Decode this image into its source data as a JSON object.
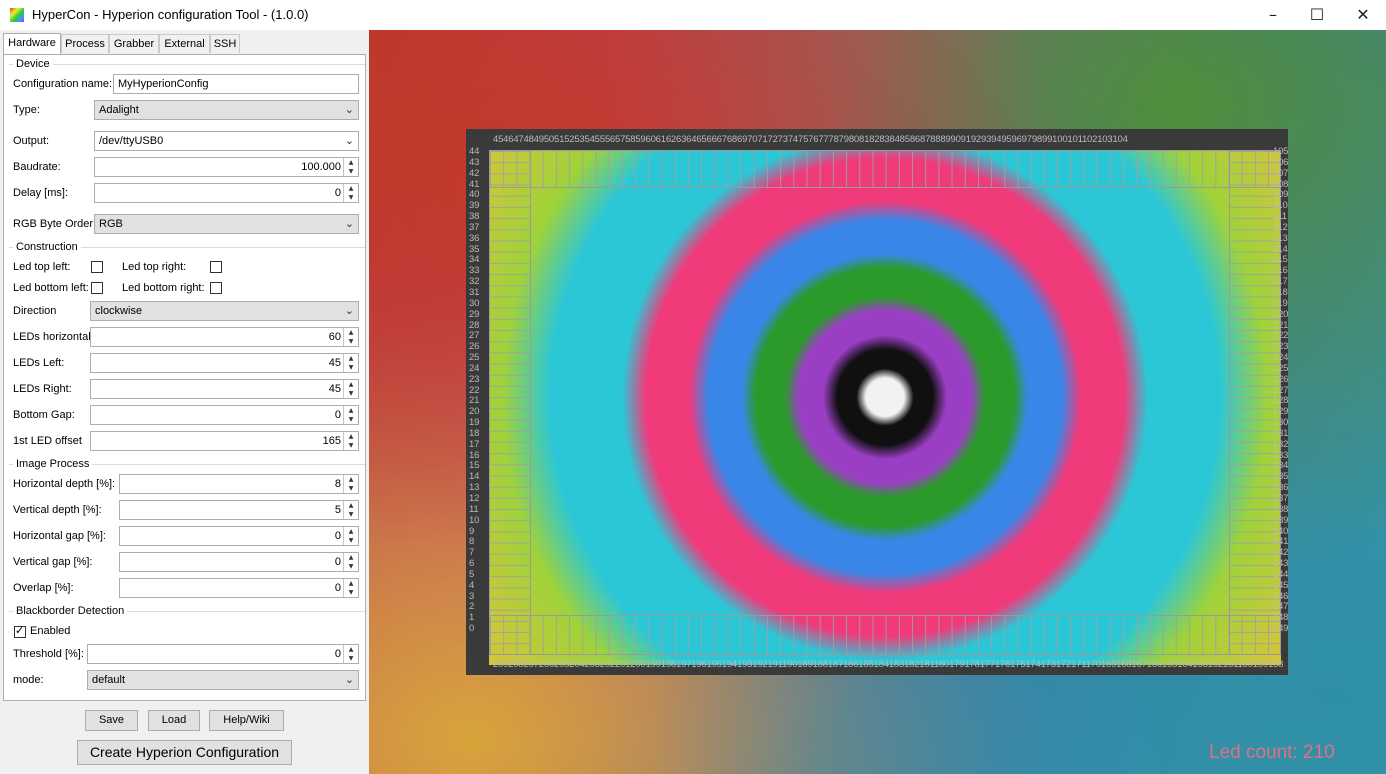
{
  "window": {
    "title": "HyperCon - Hyperion configuration Tool - (1.0.0)",
    "controls": {
      "minimize": "–",
      "maximize": "☐",
      "close": "✕"
    }
  },
  "tabs": [
    "Hardware",
    "Process",
    "Grabber",
    "External",
    "SSH"
  ],
  "device": {
    "group": "Device",
    "config_name_label": "Configuration name:",
    "config_name_value": "MyHyperionConfig",
    "type_label": "Type:",
    "type_value": "Adalight",
    "output_label": "Output:",
    "output_value": "/dev/ttyUSB0",
    "baud_label": "Baudrate:",
    "baud_value": "100.000",
    "delay_label": "Delay [ms]:",
    "delay_value": "0",
    "rgb_label": "RGB Byte Order:",
    "rgb_value": "RGB"
  },
  "construction": {
    "group": "Construction",
    "top_left_label": "Led top left:",
    "top_right_label": "Led top right:",
    "bottom_left_label": "Led bottom left:",
    "bottom_right_label": "Led bottom right:",
    "direction_label": "Direction",
    "direction_value": "clockwise",
    "horizontal_label": "LEDs horizontal:",
    "horizontal_value": "60",
    "left_label": "LEDs Left:",
    "left_value": "45",
    "right_label": "LEDs Right:",
    "right_value": "45",
    "gap_label": "Bottom Gap:",
    "gap_value": "0",
    "offset_label": "1st LED offset",
    "offset_value": "165"
  },
  "image_process": {
    "group": "Image Process",
    "hdepth_label": "Horizontal depth [%]:",
    "hdepth_value": "8",
    "vdepth_label": "Vertical depth [%]:",
    "vdepth_value": "5",
    "hgap_label": "Horizontal gap [%]:",
    "hgap_value": "0",
    "vgap_label": "Vertical gap [%]:",
    "vgap_value": "0",
    "overlap_label": "Overlap [%]:",
    "overlap_value": "0"
  },
  "blackborder": {
    "group": "Blackborder Detection",
    "enabled_label": "Enabled",
    "enabled": true,
    "threshold_label": "Threshold [%]:",
    "threshold_value": "0",
    "mode_label": "mode:",
    "mode_value": "default"
  },
  "buttons": {
    "save": "Save",
    "load": "Load",
    "help": "Help/Wiki",
    "create": "Create Hyperion Configuration"
  },
  "preview": {
    "top_numbers": "45464748495051525354555657585960616263646566676869707172737475767778798081828384858687888990919293949596979899100101102103104",
    "bottom_numbers": "209208207206205204203202201200199198197196195194193192191190189188187186185184183182181180179178177176175174173172171170169168167166165164163162161160159158157156155154153152151150",
    "left_numbers": [
      "44",
      "43",
      "42",
      "41",
      "40",
      "39",
      "38",
      "37",
      "36",
      "35",
      "34",
      "33",
      "32",
      "31",
      "30",
      "29",
      "28",
      "27",
      "26",
      "25",
      "24",
      "23",
      "22",
      "21",
      "20",
      "19",
      "18",
      "17",
      "16",
      "15",
      "14",
      "13",
      "12",
      "11",
      "10",
      "9",
      "8",
      "7",
      "6",
      "5",
      "4",
      "3",
      "2",
      "1",
      "0"
    ],
    "right_numbers": [
      "105",
      "106",
      "107",
      "108",
      "109",
      "110",
      "111",
      "112",
      "113",
      "114",
      "115",
      "116",
      "117",
      "118",
      "119",
      "120",
      "121",
      "122",
      "123",
      "124",
      "125",
      "126",
      "127",
      "128",
      "129",
      "130",
      "131",
      "132",
      "133",
      "134",
      "135",
      "136",
      "137",
      "138",
      "139",
      "140",
      "141",
      "142",
      "143",
      "144",
      "145",
      "146",
      "147",
      "148",
      "149"
    ],
    "led_count": "Led count: 210"
  }
}
